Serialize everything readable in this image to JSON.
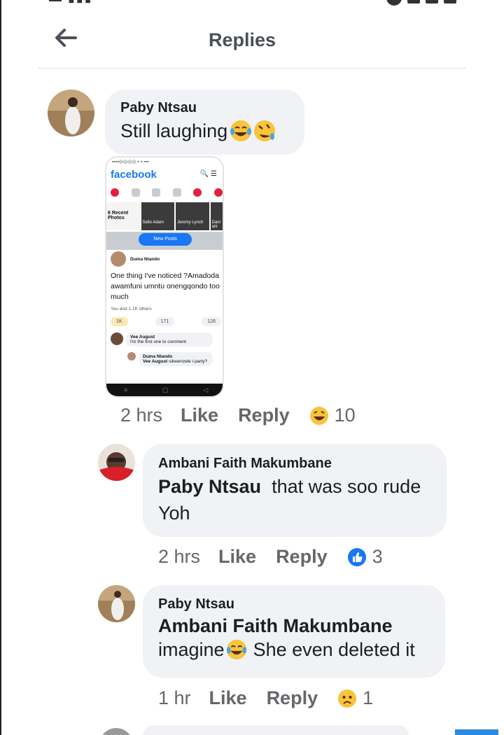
{
  "header": {
    "title": "Replies"
  },
  "comments": [
    {
      "author": "Paby Ntsau",
      "text": "Still laughing",
      "time": "2 hrs",
      "like_label": "Like",
      "reply_label": "Reply",
      "reaction_icon": "laughing-face-icon",
      "reaction_count": "10",
      "attachment": {
        "app_name": "facebook",
        "strip": [
          "6 Recent Photos",
          "Sello Adam",
          "Jeremy Lynch",
          "Dani ani"
        ],
        "new_posts_label": "New Posts",
        "post_author": "Duma Ntando",
        "post_text": "One thing I've noticed ?Amadoda awamfuni umntu onengqondo too much",
        "reactions_line": "You and 1.1K others",
        "counts": [
          "1K",
          "171",
          "126"
        ],
        "comment1_author": "Vee August",
        "comment1_text": "I'm the first one to comment",
        "comment2_author": "Duma Ntando",
        "comment2_mention": "Vee August",
        "comment2_text": "sikwenzele i-party?"
      }
    },
    {
      "author": "Ambani Faith Makumbane",
      "mention": "Paby Ntsau",
      "text": "that was soo rude Yoh",
      "time": "2 hrs",
      "like_label": "Like",
      "reply_label": "Reply",
      "reaction_icon": "like-thumb-icon",
      "reaction_count": "3"
    },
    {
      "author": "Paby Ntsau",
      "mention": "Ambani Faith Makumbane",
      "text_before": "imagine",
      "text_after": "She even deleted it",
      "time": "1 hr",
      "like_label": "Like",
      "reply_label": "Reply",
      "reaction_icon": "sad-face-icon",
      "reaction_count": "1"
    }
  ],
  "colors": {
    "accent": "#1877f2",
    "bubble": "#f0f2f5",
    "muted_text": "#65676b"
  }
}
